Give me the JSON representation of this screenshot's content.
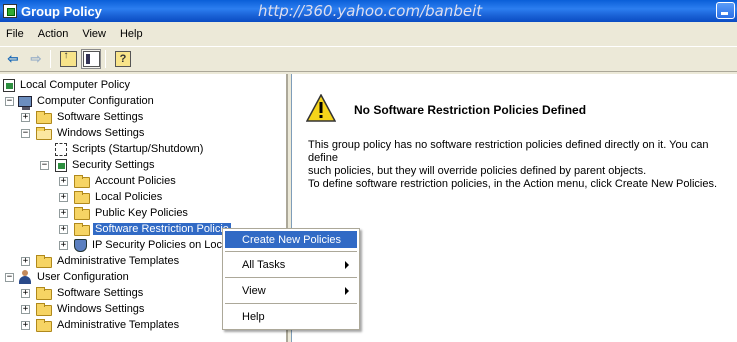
{
  "window": {
    "title": "Group Policy",
    "watermark": "http://360.yahoo.com/banbeit"
  },
  "menubar": {
    "items": [
      "File",
      "Action",
      "View",
      "Help"
    ]
  },
  "toolbar": {
    "icons": [
      "back-arrow-icon",
      "forward-arrow-icon",
      "up-folder-icon",
      "show-hide-tree-icon",
      "help-icon"
    ]
  },
  "tree": {
    "root": "Local Computer Policy",
    "computer_config": "Computer Configuration",
    "software_settings_1": "Software Settings",
    "windows_settings_1": "Windows Settings",
    "scripts": "Scripts (Startup/Shutdown)",
    "security_settings": "Security Settings",
    "account_policies": "Account Policies",
    "local_policies": "Local Policies",
    "public_key_policies": "Public Key Policies",
    "software_restriction": "Software Restriction Policie",
    "ip_security": "IP Security Policies on Loca",
    "admin_templates_1": "Administrative Templates",
    "user_config": "User Configuration",
    "software_settings_2": "Software Settings",
    "windows_settings_2": "Windows Settings",
    "admin_templates_2": "Administrative Templates"
  },
  "details": {
    "heading": "No Software Restriction Policies Defined",
    "para1_line1": "This group policy has no software restriction policies defined directly on it. You can define",
    "para1_line2": "such policies, but they will override policies defined by parent objects.",
    "para2": "To define software restriction policies, in the Action menu, click Create New Policies."
  },
  "context_menu": {
    "create_new": "Create New Policies",
    "all_tasks": "All Tasks",
    "view": "View",
    "help": "Help"
  }
}
